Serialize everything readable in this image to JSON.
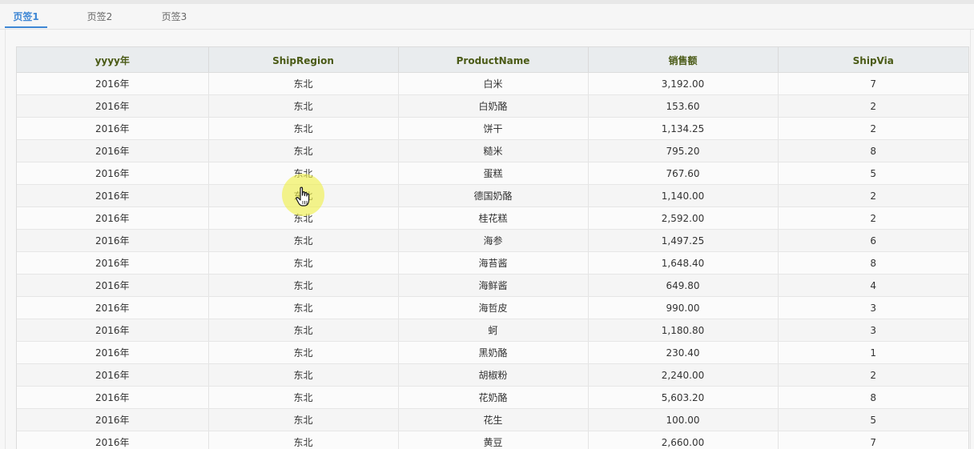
{
  "tabs": [
    {
      "label": "页签1",
      "active": true
    },
    {
      "label": "页签2",
      "active": false
    },
    {
      "label": "页签3",
      "active": false
    }
  ],
  "table": {
    "columns": [
      "yyyy年",
      "ShipRegion",
      "ProductName",
      "销售额",
      "ShipVia"
    ],
    "rows": [
      [
        "2016年",
        "东北",
        "白米",
        "3,192.00",
        "7"
      ],
      [
        "2016年",
        "东北",
        "白奶酪",
        "153.60",
        "2"
      ],
      [
        "2016年",
        "东北",
        "饼干",
        "1,134.25",
        "2"
      ],
      [
        "2016年",
        "东北",
        "糙米",
        "795.20",
        "8"
      ],
      [
        "2016年",
        "东北",
        "蛋糕",
        "767.60",
        "5"
      ],
      [
        "2016年",
        "东北",
        "德国奶酪",
        "1,140.00",
        "2"
      ],
      [
        "2016年",
        "东北",
        "桂花糕",
        "2,592.00",
        "2"
      ],
      [
        "2016年",
        "东北",
        "海参",
        "1,497.25",
        "6"
      ],
      [
        "2016年",
        "东北",
        "海苔酱",
        "1,648.40",
        "8"
      ],
      [
        "2016年",
        "东北",
        "海鲜酱",
        "649.80",
        "4"
      ],
      [
        "2016年",
        "东北",
        "海哲皮",
        "990.00",
        "3"
      ],
      [
        "2016年",
        "东北",
        "蚵",
        "1,180.80",
        "3"
      ],
      [
        "2016年",
        "东北",
        "黑奶酪",
        "230.40",
        "1"
      ],
      [
        "2016年",
        "东北",
        "胡椒粉",
        "2,240.00",
        "2"
      ],
      [
        "2016年",
        "东北",
        "花奶酪",
        "5,603.20",
        "8"
      ],
      [
        "2016年",
        "东北",
        "花生",
        "100.00",
        "5"
      ],
      [
        "2016年",
        "东北",
        "黄豆",
        "2,660.00",
        "7"
      ]
    ]
  },
  "colors": {
    "accent": "#3d86d4",
    "header_bg": "#e9ecee",
    "header_text": "#4a5a16",
    "cursor_highlight": "#f0f050"
  },
  "cursor": {
    "icon": "hand-pointer-icon"
  }
}
